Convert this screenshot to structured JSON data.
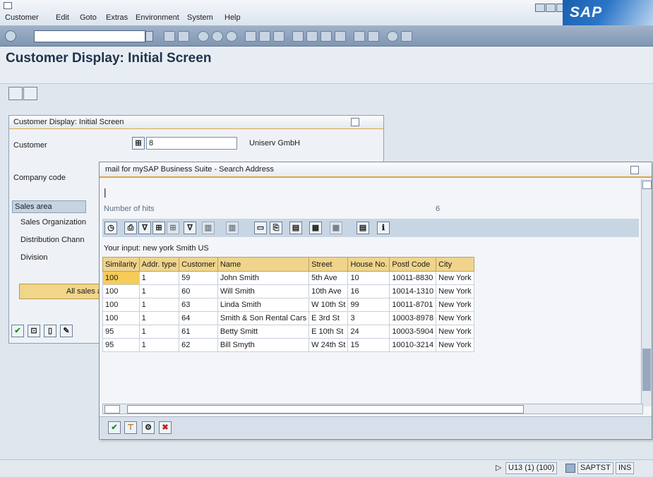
{
  "menu": [
    "Customer",
    "Edit",
    "Goto",
    "Extras",
    "Environment",
    "System",
    "Help"
  ],
  "logo": "SAP",
  "page_title": "Customer Display: Initial Screen",
  "form": {
    "header": "Customer Display: Initial Screen",
    "customer_label": "Customer",
    "customer_value": "8",
    "customer_name": "Uniserv GmbH",
    "company_code_label": "Company code",
    "sales_area_tab": "Sales area",
    "sales_org_label": "Sales Organization",
    "dist_channel_label": "Distribution Chann",
    "division_label": "Division",
    "all_sales_btn": "All sales a"
  },
  "popup": {
    "title": "mail for mySAP Business Suite - Search Address",
    "cursor": "|",
    "hits_label": "Number of hits",
    "hits_value": "6",
    "input_text": "Your input: new york Smith US",
    "columns": [
      "Similarity",
      "Addr. type",
      "Customer",
      "Name",
      "Street",
      "House No.",
      "Postl Code",
      "City"
    ],
    "rows": [
      [
        "100",
        "1",
        "59",
        "John Smith",
        "5th Ave",
        "10",
        "10011-8830",
        "New York"
      ],
      [
        "100",
        "1",
        "60",
        "Will Smith",
        "10th Ave",
        "16",
        "10014-1310",
        "New York"
      ],
      [
        "100",
        "1",
        "63",
        "Linda Smith",
        "W 10th St",
        "99",
        "10011-8701",
        "New York"
      ],
      [
        "100",
        "1",
        "64",
        "Smith & Son Rental Cars",
        "E 3rd St",
        "3",
        "10003-8978",
        "New York"
      ],
      [
        "95",
        "1",
        "61",
        "Betty Smitt",
        "E 10th St",
        "24",
        "10003-5904",
        "New York"
      ],
      [
        "95",
        "1",
        "62",
        "Bill Smyth",
        "W 24th St",
        "15",
        "10010-3214",
        "New York"
      ]
    ]
  },
  "status": {
    "session": "U13 (1) (100)",
    "system": "SAPTST",
    "mode": "INS"
  }
}
